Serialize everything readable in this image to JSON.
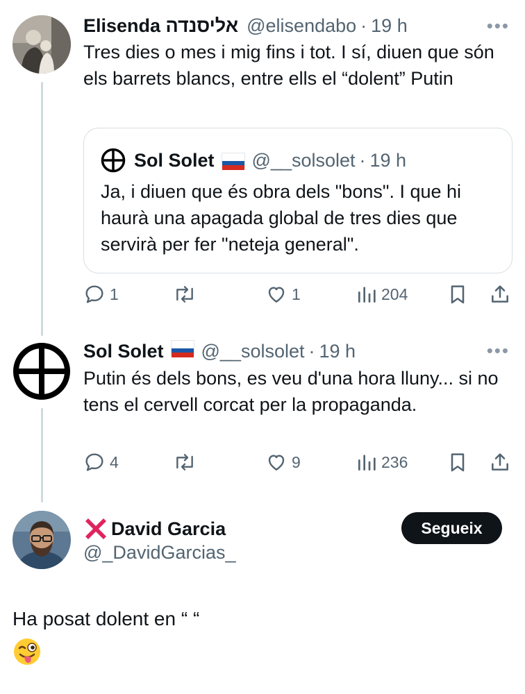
{
  "tweet1": {
    "name": "Elisenda אליסנדה",
    "handle": "@elisendabo",
    "separator": "·",
    "time": "19 h",
    "more": "•••",
    "text": "Tres dies o mes i mig fins i tot. I sí, diuen que són els barrets blancs, entre ells el “dolent” Putin",
    "quote": {
      "name": "Sol Solet",
      "handle": "@__solsolet",
      "separator": "·",
      "time": "19 h",
      "text": "Ja, i diuen que és obra dels \"bons\". I que hi haurà una apagada global de tres dies que servirà per fer \"neteja general\"."
    },
    "actions": {
      "replies": "1",
      "reposts": "",
      "likes": "1",
      "views": "204"
    }
  },
  "tweet2": {
    "name": "Sol Solet",
    "handle": "@__solsolet",
    "separator": "·",
    "time": "19 h",
    "more": "•••",
    "text": "Putin és dels bons, es veu d'una hora lluny... si no tens el cervell corcat per la propaganda.",
    "actions": {
      "replies": "4",
      "reposts": "",
      "likes": "9",
      "views": "236"
    }
  },
  "tweet3": {
    "name": "David Garcia",
    "name_prefix_emoji": "❌",
    "handle": "@_DavidGarcias_",
    "follow_label": "Segueix",
    "text": "Ha posat dolent en “   “",
    "emoji": "😜"
  },
  "colors": {
    "text": "#0f1419",
    "secondary": "#536471",
    "border": "#d7dde1",
    "thread_line": "#cfd9de",
    "follow_bg": "#0f1419"
  }
}
